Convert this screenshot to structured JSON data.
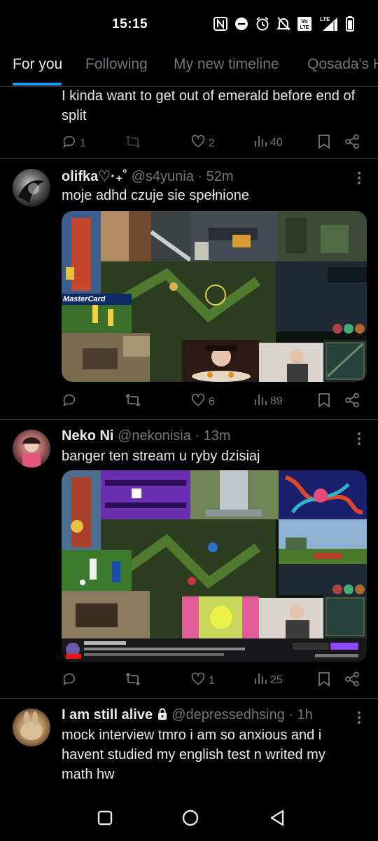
{
  "status_bar": {
    "time": "15:15",
    "icons": [
      "nfc-icon",
      "do-not-disturb-icon",
      "alarm-icon",
      "muted-bell-icon",
      "volte-icon",
      "lte-signal-icon",
      "battery-icon"
    ],
    "volte_line1": "Vo",
    "volte_line2": "LTE",
    "lte_label": "LTE"
  },
  "tabs": [
    {
      "label": "For you",
      "active": true
    },
    {
      "label": "Following",
      "active": false
    },
    {
      "label": "My new timeline",
      "active": false
    },
    {
      "label": "Qosada's H",
      "active": false
    }
  ],
  "posts": [
    {
      "text": "I kinda want to get out of emerald before end of split",
      "replies": "1",
      "reposts": "",
      "likes": "2",
      "views": "40"
    },
    {
      "name": "olifka♡·₊˚",
      "handle": "@s4yunia",
      "time": "52m",
      "text": "moje adhd czuje sie spełnione",
      "replies": "",
      "reposts": "",
      "likes": "6",
      "views": "89",
      "media_labels": {
        "mastercard": "MasterCard"
      }
    },
    {
      "name": "Neko Ni",
      "handle": "@nekonisia",
      "time": "13m",
      "text": "banger ten stream u ryby dzisiaj",
      "replies": "",
      "reposts": "",
      "likes": "1",
      "views": "25"
    },
    {
      "name": "I am still alive",
      "handle": "@depressedhsing",
      "time": "1h",
      "text": "mock interview tmro i am so anxious and i havent studied my english test n writed my math hw"
    }
  ],
  "colors": {
    "accent": "#1d9bf0",
    "muted": "#71767b",
    "text": "#e7e9ea",
    "divider": "#2f3336"
  }
}
